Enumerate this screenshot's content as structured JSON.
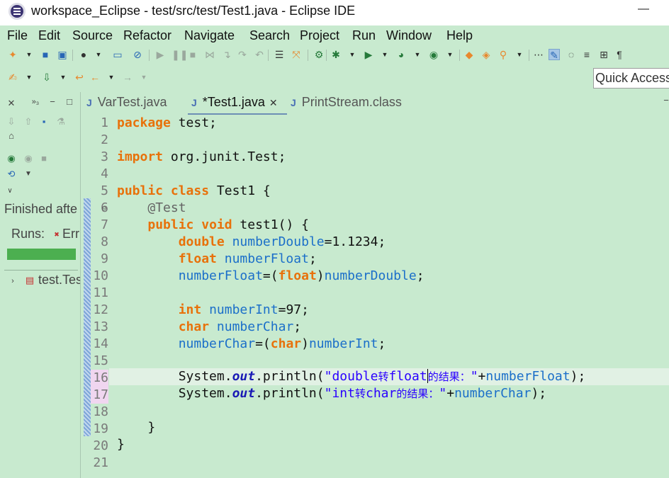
{
  "window": {
    "title": "workspace_Eclipse - test/src/test/Test1.java - Eclipse IDE",
    "minimize_glyph": "—"
  },
  "menu": [
    "File",
    "Edit",
    "Source",
    "Refactor",
    "Navigate",
    "Search",
    "Project",
    "Run",
    "Window",
    "Help"
  ],
  "quick_access": "Quick Access",
  "junit_panel": {
    "status": "Finished afte",
    "runs_label": "Runs:",
    "errors_label": "Err",
    "tree_item": "test.Tes",
    "progress_color": "#4caf50"
  },
  "tabs": [
    {
      "label": "VarTest.java",
      "dirty": false
    },
    {
      "label": "*Test1.java",
      "dirty": true,
      "active": true
    },
    {
      "label": "PrintStream.class",
      "dirty": false
    }
  ],
  "editor": {
    "line_numbers": [
      "1",
      "2",
      "3",
      "4",
      "5",
      "6",
      "7",
      "8",
      "9",
      "10",
      "11",
      "12",
      "13",
      "14",
      "15",
      "16",
      "17",
      "18",
      "19",
      "20",
      "21"
    ],
    "code": {
      "l1": {
        "kw": "package",
        "rest": " test;"
      },
      "l3": {
        "kw": "import",
        "rest": " org.junit.Test;"
      },
      "l5": {
        "kw1": "public",
        "kw2": "class",
        "rest": " Test1 {"
      },
      "l6": {
        "annotation": "@Test"
      },
      "l7": {
        "kw1": "public",
        "kw2": "void",
        "rest": " test1() {"
      },
      "l8": {
        "kw": "double",
        "var": "numberDouble",
        "rest": "=1.1234;"
      },
      "l9": {
        "kw": "float",
        "var": "numberFloat",
        "rest": ";"
      },
      "l10": {
        "var1": "numberFloat",
        "op1": "=(",
        "kw": "float",
        "op2": ")",
        "var2": "numberDouble",
        "rest": ";"
      },
      "l12": {
        "kw": "int",
        "var": "numberInt",
        "rest": "=97;"
      },
      "l13": {
        "kw": "char",
        "var": "numberChar",
        "rest": ";"
      },
      "l14": {
        "var1": "numberChar",
        "op1": "=(",
        "kw": "char",
        "op2": ")",
        "var2": "numberInt",
        "rest": ";"
      },
      "l16": {
        "prefix": "System.",
        "field": "out",
        "mid": ".println(",
        "str1": "\"double",
        "cjk1": "转",
        "str2": "float",
        "cjk2": "的结果：",
        "str3": "\"",
        "plus": "+",
        "var": "numberFloat",
        "end": ");"
      },
      "l17": {
        "prefix": "System.",
        "field": "out",
        "mid": ".println(",
        "str1": "\"int",
        "cjk1": "转",
        "str2": "char",
        "cjk2": "的结果：",
        "str3": "\"",
        "plus": "+",
        "var": "numberChar",
        "end": ");"
      },
      "l19": {
        "rest": "}"
      },
      "l20": {
        "rest": "}"
      }
    }
  }
}
